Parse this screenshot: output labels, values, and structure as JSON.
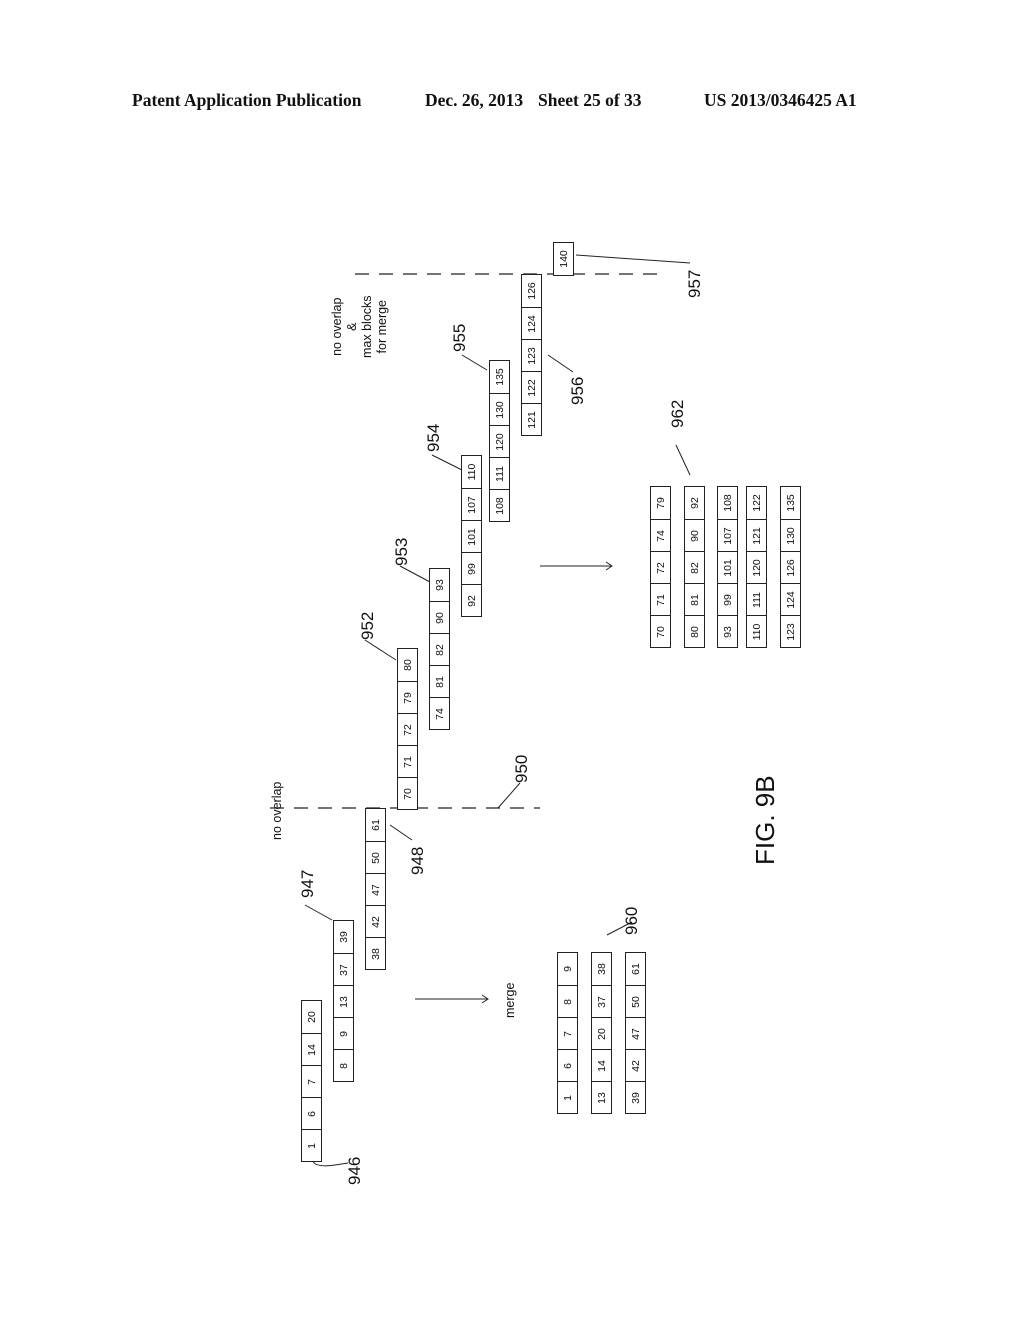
{
  "header": {
    "publication": "Patent Application Publication",
    "date": "Dec. 26, 2013",
    "sheet": "Sheet 25 of 33",
    "number": "US 2013/0346425 A1"
  },
  "figure": {
    "label": "FIG. 9B",
    "blocks": [
      {
        "ref": "946",
        "values": [
          "1",
          "6",
          "7",
          "14",
          "20"
        ]
      },
      {
        "ref": "947",
        "values": [
          "8",
          "9",
          "13",
          "37",
          "39"
        ]
      },
      {
        "ref": "948",
        "values": [
          "38",
          "42",
          "47",
          "50",
          "61"
        ]
      },
      {
        "ref": "952",
        "values": [
          "70",
          "71",
          "72",
          "79",
          "80"
        ]
      },
      {
        "ref": "953",
        "values": [
          "74",
          "81",
          "82",
          "90",
          "93"
        ]
      },
      {
        "ref": "954",
        "values": [
          "92",
          "99",
          "101",
          "107",
          "110"
        ]
      },
      {
        "ref": "955",
        "values": [
          "108",
          "111",
          "120",
          "130",
          "135"
        ]
      },
      {
        "ref": "956",
        "values": [
          "121",
          "122",
          "123",
          "124",
          "126"
        ]
      },
      {
        "ref": "957",
        "values": [
          "140"
        ]
      }
    ],
    "merged_group_960": {
      "ref": "960",
      "rows": [
        [
          "1",
          "6",
          "7",
          "8",
          "9"
        ],
        [
          "13",
          "14",
          "20",
          "37",
          "38"
        ],
        [
          "39",
          "42",
          "47",
          "50",
          "61"
        ]
      ]
    },
    "merged_group_962": {
      "ref": "962",
      "rows": [
        [
          "70",
          "71",
          "72",
          "74",
          "79"
        ],
        [
          "80",
          "81",
          "82",
          "90",
          "92"
        ],
        [
          "93",
          "99",
          "101",
          "107",
          "108"
        ],
        [
          "110",
          "111",
          "120",
          "121",
          "122"
        ],
        [
          "123",
          "124",
          "126",
          "130",
          "135"
        ]
      ]
    },
    "annotations": {
      "no_overlap": "no overlap",
      "no_overlap_max_line1": "no overlap",
      "no_overlap_max_line2": "&",
      "no_overlap_max_line3": "max blocks",
      "no_overlap_max_line4": "for merge",
      "merge": "merge",
      "ref_950": "950"
    }
  }
}
